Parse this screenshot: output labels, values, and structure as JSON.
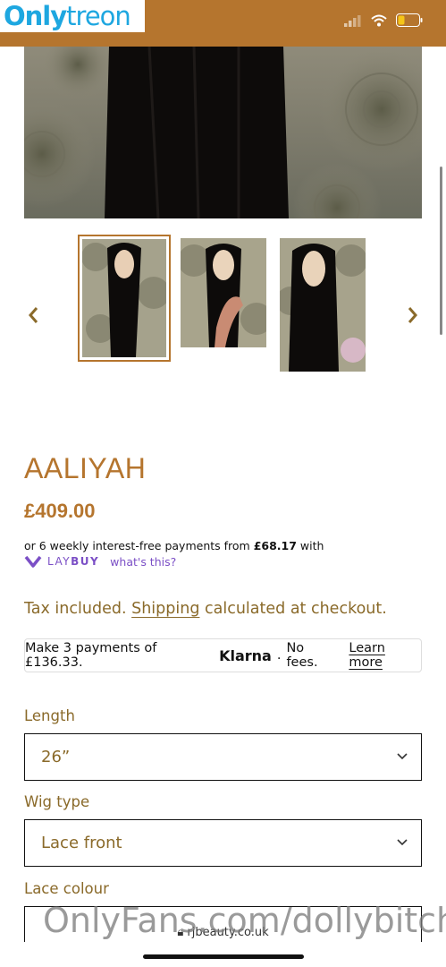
{
  "watermark": {
    "brand_a": "Only",
    "brand_b": "treon",
    "bottom": "OnlyFans.com/dollybitch"
  },
  "status_icons": [
    "signal-icon",
    "wifi-icon",
    "battery-icon"
  ],
  "colors": {
    "accent": "#b5752e",
    "laybuy": "#7b4fc6",
    "label": "#8a6a2a"
  },
  "product": {
    "title": "AALIYAH",
    "price": "£409.00",
    "laybuy_text_prefix": "or 6 weekly interest-free payments from ",
    "laybuy_amount": "£68.17",
    "laybuy_text_suffix": " with",
    "laybuy_brand_a": "LAY",
    "laybuy_brand_b": "BUY",
    "laybuy_link": "what's this?",
    "tax_prefix": "Tax included.",
    "tax_link": "Shipping",
    "tax_suffix": "calculated at checkout.",
    "klarna_prefix": "Make 3 payments of £136.33.",
    "klarna_brand": "Klarna",
    "klarna_suffix": "No fees.",
    "klarna_link": "Learn more"
  },
  "options": [
    {
      "label": "Length",
      "value": "26”"
    },
    {
      "label": "Wig type",
      "value": "Lace front"
    },
    {
      "label": "Lace colour",
      "value": ""
    }
  ],
  "browser": {
    "url": "rjbeauty.co.uk"
  }
}
